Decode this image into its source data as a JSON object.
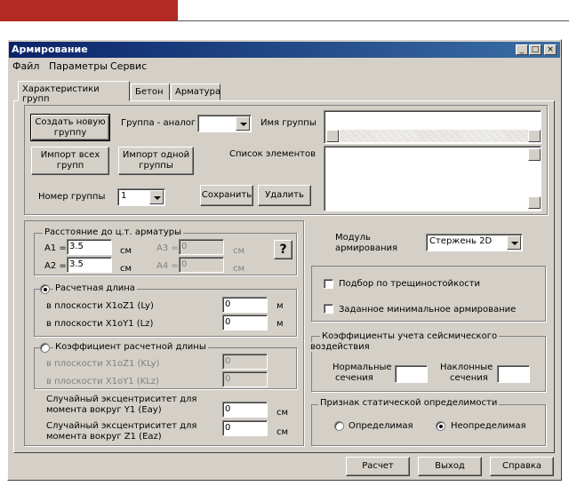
{
  "window": {
    "title": "Армирование",
    "minimize": "_",
    "maximize": "□",
    "close": "×"
  },
  "menu": [
    "Файл",
    "Параметры",
    "Сервис"
  ],
  "tabs": [
    "Характеристики групп",
    "Бетон",
    "Арматура"
  ],
  "group_section": {
    "create_btn": "Создать новую группу",
    "analog_label": "Группа - аналог",
    "analog_value": "",
    "group_name_label": "Имя группы",
    "import_all_btn": "Импорт всех групп",
    "import_one_btn": "Импорт одной группы",
    "elements_label": "Список элементов",
    "group_num_label": "Номер группы",
    "group_num_value": "1",
    "save_btn": "Сохранить",
    "delete_btn": "Удалить"
  },
  "distance": {
    "legend": "Расстояние до ц.т. арматуры",
    "a1_label": "A1 =",
    "a1_value": "3.5",
    "a1_unit": "см",
    "a2_label": "A2 =",
    "a2_value": "3.5",
    "a2_unit": "см",
    "a3_label": "A3 =",
    "a3_value": "0",
    "a3_unit": "см",
    "a4_label": "A4 =",
    "a4_value": "0",
    "a4_unit": "см",
    "help_btn": "?"
  },
  "calc_length": {
    "legend": "Расчетная длина",
    "ly_label": "в плоскости X1oZ1  (Ly)",
    "ly_value": "0",
    "ly_unit": "м",
    "lz_label": "в плоскости X1oY1  (Lz)",
    "lz_value": "0",
    "lz_unit": "м"
  },
  "coef": {
    "legend": "Коэффициент расчетной длины",
    "kly_label": "в плоскости X1oZ1  (KLy)",
    "kly_value": "0",
    "klz_label": "в плоскости X1oY1  (KLz)",
    "klz_value": "0"
  },
  "ecc": {
    "eay_label1": "Случайный эксцентриситет для",
    "eay_label2": "момента вокруг Y1  (Eay)",
    "eay_value": "0",
    "eay_unit": "см",
    "eaz_label1": "Случайный эксцентриситет для",
    "eaz_label2": "момента вокруг Z1  (Eaz)",
    "eaz_value": "0",
    "eaz_unit": "см"
  },
  "module": {
    "label1": "Модуль",
    "label2": "армирования",
    "value": "Стержень 2D"
  },
  "options": {
    "crack": "Подбор по трещиностойкости",
    "min_reinf": "Заданное минимальное армирование"
  },
  "seismic": {
    "legend1": "Коэффициенты учета сейсмического",
    "legend2": "воздействия",
    "normal1": "Нормальные",
    "normal2": "сечения",
    "normal_value": "",
    "inclined1": "Наклонные",
    "inclined2": "сечения",
    "inclined_value": ""
  },
  "static": {
    "legend": "Признак статической определимости",
    "determinate": "Определимая",
    "indeterminate": "Неопределимая"
  },
  "footer": {
    "calc": "Расчет",
    "exit": "Выход",
    "help": "Справка"
  }
}
